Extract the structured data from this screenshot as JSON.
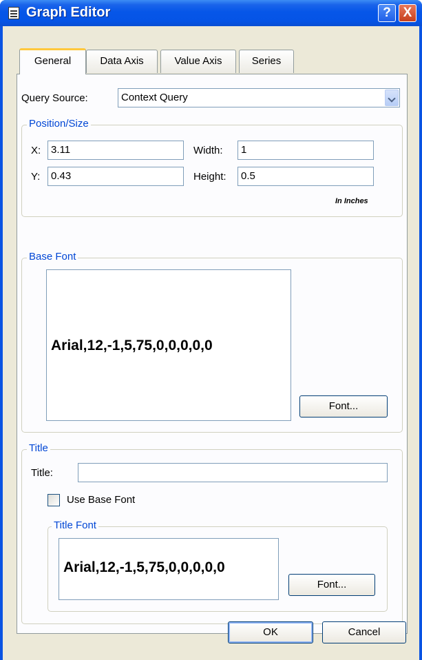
{
  "window": {
    "title": "Graph Editor",
    "help_label": "?",
    "close_label": "X"
  },
  "tabs": [
    "General",
    "Data Axis",
    "Value Axis",
    "Series"
  ],
  "query_source": {
    "label": "Query Source:",
    "value": "Context Query"
  },
  "position_size": {
    "legend": "Position/Size",
    "x_label": "X:",
    "x_value": "3.11",
    "y_label": "Y:",
    "y_value": "0.43",
    "width_label": "Width:",
    "width_value": "1",
    "height_label": "Height:",
    "height_value": "0.5",
    "units_note": "In Inches"
  },
  "base_font": {
    "legend": "Base Font",
    "preview": "Arial,12,-1,5,75,0,0,0,0,0",
    "button": "Font..."
  },
  "title_group": {
    "legend": "Title",
    "title_label": "Title:",
    "title_value": "",
    "use_base_font_label": "Use Base Font",
    "use_base_font_checked": false,
    "title_font": {
      "legend": "Title Font",
      "preview": "Arial,12,-1,5,75,0,0,0,0,0",
      "button": "Font..."
    }
  },
  "footer": {
    "ok": "OK",
    "cancel": "Cancel"
  }
}
